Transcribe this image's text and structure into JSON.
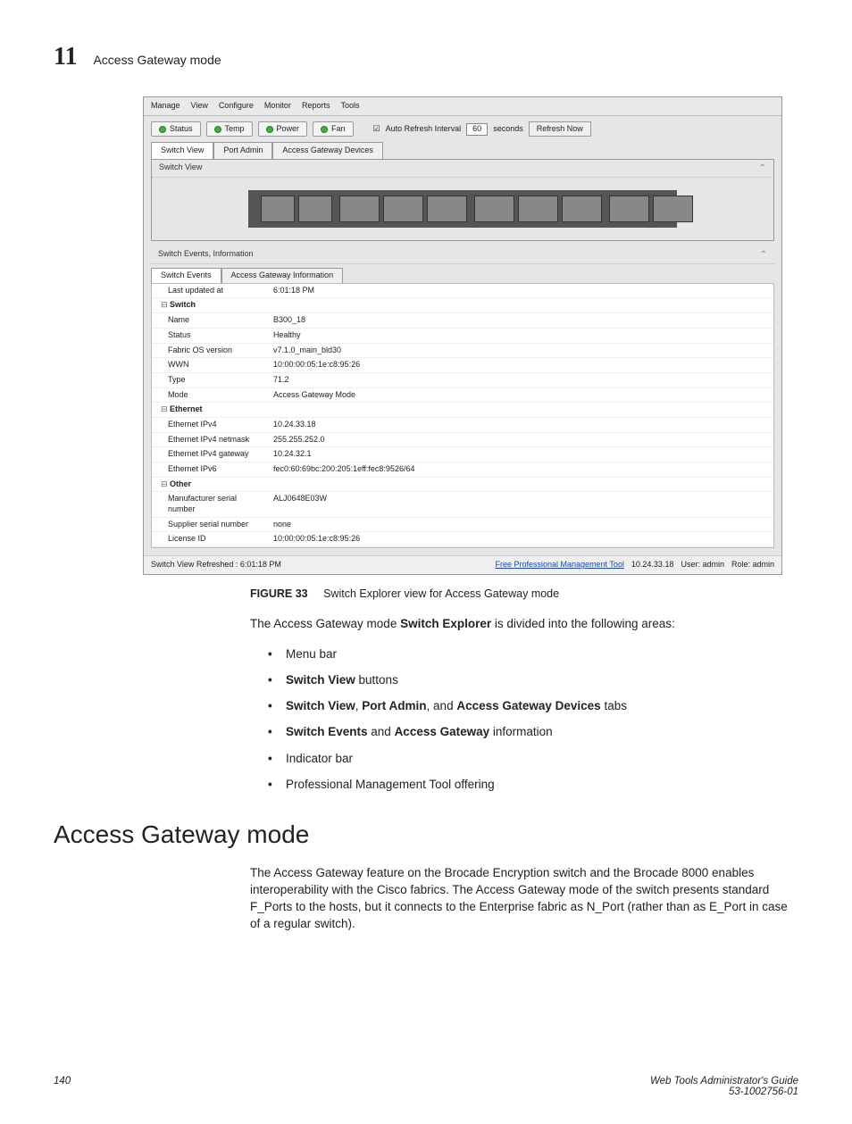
{
  "page": {
    "chapter_number": "11",
    "chapter_title": "Access Gateway mode",
    "page_number": "140",
    "footer_title": "Web Tools Administrator's Guide",
    "footer_doc": "53-1002756-01"
  },
  "screenshot": {
    "menus": [
      "Manage",
      "View",
      "Configure",
      "Monitor",
      "Reports",
      "Tools"
    ],
    "indicators": [
      {
        "label": "Status"
      },
      {
        "label": "Temp"
      },
      {
        "label": "Power"
      },
      {
        "label": "Fan"
      }
    ],
    "auto_refresh_label": "Auto Refresh Interval",
    "auto_refresh_value": "60",
    "auto_refresh_unit": "seconds",
    "refresh_now": "Refresh Now",
    "top_tabs": [
      {
        "label": "Switch View",
        "active": true
      },
      {
        "label": "Port Admin",
        "active": false
      },
      {
        "label": "Access Gateway Devices",
        "active": false
      }
    ],
    "switch_view_title": "Switch View",
    "events_panel_title": "Switch Events, Information",
    "info_tabs": [
      {
        "label": "Switch Events",
        "active": true
      },
      {
        "label": "Access Gateway Information",
        "active": false
      }
    ],
    "rows": [
      {
        "k": "Last updated at",
        "v": "6:01:18 PM"
      },
      {
        "section": "Switch"
      },
      {
        "k": "Name",
        "v": "B300_18"
      },
      {
        "k": "Status",
        "v": "Healthy"
      },
      {
        "k": "Fabric OS version",
        "v": "v7.1.0_main_bld30"
      },
      {
        "k": "WWN",
        "v": "10:00:00:05:1e:c8:95:26"
      },
      {
        "k": "Type",
        "v": "71.2"
      },
      {
        "k": "Mode",
        "v": "Access Gateway Mode"
      },
      {
        "section": "Ethernet"
      },
      {
        "k": "Ethernet IPv4",
        "v": "10.24.33.18"
      },
      {
        "k": "Ethernet IPv4 netmask",
        "v": "255.255.252.0"
      },
      {
        "k": "Ethernet IPv4 gateway",
        "v": "10.24.32.1"
      },
      {
        "k": "Ethernet IPv6",
        "v": "fec0:60:69bc:200:205:1eff:fec8:9526/64"
      },
      {
        "section": "Other"
      },
      {
        "k": "Manufacturer serial number",
        "v": "ALJ0648E03W"
      },
      {
        "k": "Supplier serial number",
        "v": "none"
      },
      {
        "k": "License ID",
        "v": "10:00:00:05:1e:c8:95:26"
      }
    ],
    "status_left": "Switch View Refreshed : 6:01:18 PM",
    "status_link": "Free Professional Management Tool",
    "status_ip": "10.24.33.18",
    "status_user": "User: admin",
    "status_role": "Role: admin"
  },
  "caption": {
    "label": "FIGURE 33",
    "text": "Switch Explorer view for Access Gateway mode"
  },
  "body": {
    "intro_pre": "The Access Gateway mode ",
    "intro_bold": "Switch Explorer",
    "intro_post": " is divided into the following areas:",
    "bullets": [
      {
        "pre": "",
        "b": "",
        "post": "Menu bar"
      },
      {
        "pre": "",
        "b": "Switch View",
        "post": " buttons"
      },
      {
        "pre": "",
        "b": "Switch View",
        "mid": ", ",
        "b2": "Port Admin",
        "mid2": ", and ",
        "b3": "Access Gateway Devices",
        "post": " tabs"
      },
      {
        "pre": "",
        "b": "Switch Events",
        "mid": " and ",
        "b2": "Access Gateway",
        "post": " information"
      },
      {
        "pre": "",
        "b": "",
        "post": "Indicator bar"
      },
      {
        "pre": "",
        "b": "",
        "post": "Professional Management Tool offering"
      }
    ],
    "section_heading": "Access Gateway mode",
    "section_body": "The Access Gateway feature on the Brocade Encryption switch and the Brocade 8000 enables interoperability with the Cisco fabrics. The Access Gateway mode of the switch presents standard F_Ports to the hosts, but it connects to the Enterprise fabric as N_Port (rather than as E_Port in case of a regular switch)."
  }
}
